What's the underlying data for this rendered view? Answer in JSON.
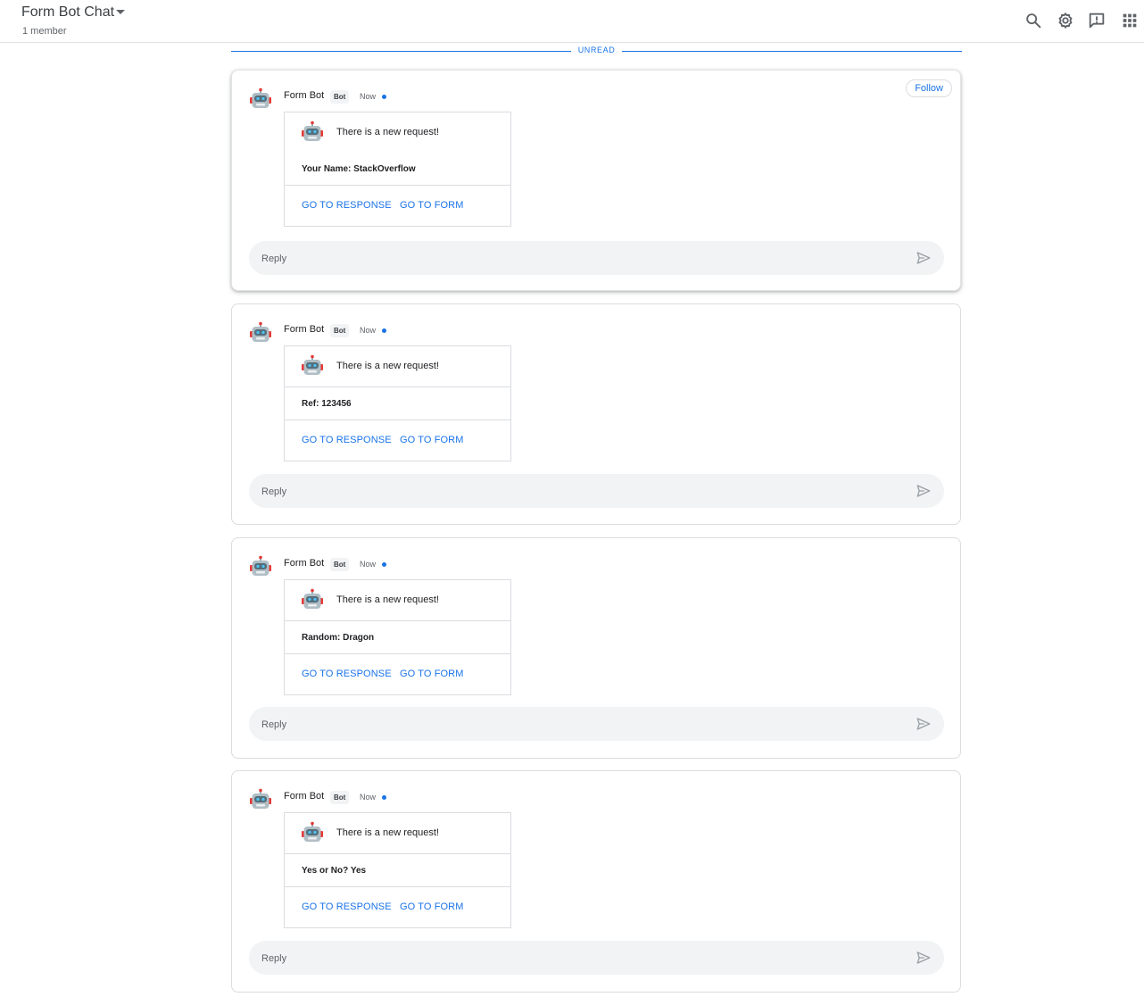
{
  "header": {
    "title": "Form Bot Chat",
    "subtitle": "1 member",
    "icons": [
      "search-icon",
      "settings-icon",
      "feedback-icon",
      "apps-grid-icon"
    ]
  },
  "divider": {
    "label": "UNREAD"
  },
  "colors": {
    "accent": "#1a73e8",
    "reply_bg": "#f1f3f4",
    "border": "#dadce0",
    "text": "#202124"
  },
  "threads": [
    {
      "sender": "Form Bot",
      "badge": "Bot",
      "time": "Now",
      "follow": "Follow",
      "card": {
        "header": "There is a new request!",
        "field": "Your Name: StackOverflow",
        "button_response": "GO TO RESPONSE",
        "button_form": "GO TO FORM"
      },
      "reply_placeholder": "Reply"
    },
    {
      "sender": "Form Bot",
      "badge": "Bot",
      "time": "Now",
      "card": {
        "header": "There is a new request!",
        "field": "Ref: 123456",
        "button_response": "GO TO RESPONSE",
        "button_form": "GO TO FORM"
      },
      "reply_placeholder": "Reply"
    },
    {
      "sender": "Form Bot",
      "badge": "Bot",
      "time": "Now",
      "card": {
        "header": "There is a new request!",
        "field": "Random: Dragon",
        "button_response": "GO TO RESPONSE",
        "button_form": "GO TO FORM"
      },
      "reply_placeholder": "Reply"
    },
    {
      "sender": "Form Bot",
      "badge": "Bot",
      "time": "Now",
      "card": {
        "header": "There is a new request!",
        "field": "Yes or No? Yes",
        "button_response": "GO TO RESPONSE",
        "button_form": "GO TO FORM"
      },
      "reply_placeholder": "Reply"
    }
  ]
}
